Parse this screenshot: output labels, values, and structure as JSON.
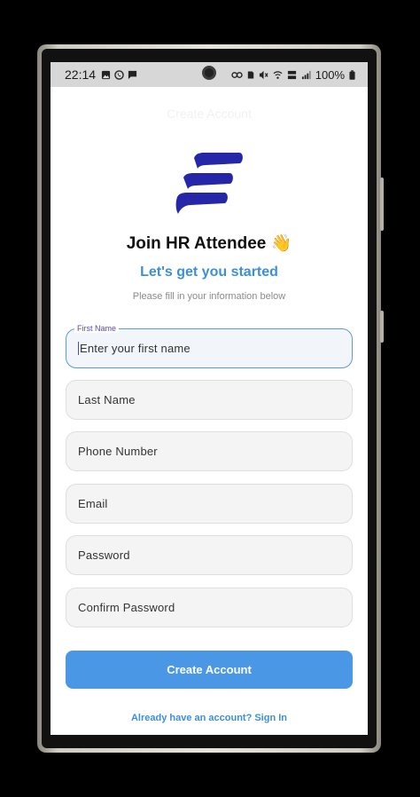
{
  "status_bar": {
    "time": "22:14",
    "battery": "100%",
    "left_icons": [
      "gallery-icon",
      "whatsapp-icon",
      "message-icon"
    ],
    "right_icons": [
      "key-icon",
      "sim-icon",
      "mute-icon",
      "wifi-icon",
      "volte-icon",
      "signal-icon",
      "battery-icon"
    ]
  },
  "header": {
    "ghost_title": "Create Account"
  },
  "brand": {
    "title": "Join HR Attendee 👋",
    "subtitle": "Let's get you started",
    "hint": "Please fill in your information below",
    "logo_color": "#2626a8"
  },
  "form": {
    "first_name": {
      "label": "First Name",
      "placeholder": "Enter your first name"
    },
    "last_name": {
      "placeholder": "Last Name"
    },
    "phone": {
      "placeholder": "Phone Number"
    },
    "email": {
      "placeholder": "Email"
    },
    "password": {
      "placeholder": "Password"
    },
    "confirm_password": {
      "placeholder": "Confirm Password"
    }
  },
  "actions": {
    "create_account": "Create Account",
    "sign_in": "Already have an account? Sign In"
  },
  "colors": {
    "accent": "#4a97e6",
    "link": "#3d8fd6"
  }
}
